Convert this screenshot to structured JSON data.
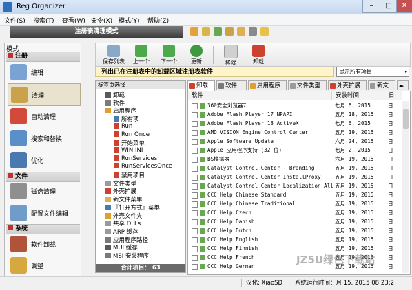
{
  "window": {
    "title": "Reg Organizer",
    "min_glyph": "–",
    "max_glyph": "□",
    "close_glyph": "✕"
  },
  "menu": [
    "文件(S)",
    "搜索(T)",
    "查看(W)",
    "命令(X)",
    "模式(Y)",
    "帮助(Z)"
  ],
  "mode_bar": {
    "title": "注册表清理模式"
  },
  "sidebar": {
    "header": "模式",
    "sections": [
      {
        "title": "注册",
        "items": [
          "编辑",
          "清理",
          "自动清理",
          "搜索和替换",
          "优化"
        ]
      },
      {
        "title": "文件",
        "items": [
          "磁盘清理",
          "配置文件编辑"
        ]
      },
      {
        "title": "系统",
        "items": [
          "软件卸载",
          "调整"
        ]
      }
    ],
    "selected": "清理"
  },
  "toolbar": {
    "buttons": [
      "保存列表",
      "上一个",
      "下一个",
      "更新",
      "移除",
      "卸载"
    ]
  },
  "description": "列出已在注册表中的卸载区域注册表软件",
  "filter": {
    "selected": "显示所有项目",
    "arrow": "▾"
  },
  "tree": {
    "header": "标签页选择",
    "nodes": [
      "卸载",
      "软件",
      "启用程序",
      "所有项",
      "Run",
      "Run Once",
      "开始菜单",
      "WIN.INI",
      "RunServices",
      "RunServicesOnce",
      "禁用项目",
      "文件类型",
      "外壳扩展",
      "新文件菜单",
      "『打开方式』菜单",
      "外壳文件夹",
      "共享 DLLs",
      "ARP 缓存",
      "应用程序路径",
      "MUI 缓存",
      "MSI 安装程序"
    ],
    "total_label": "合计项目：",
    "total": "63"
  },
  "tabs": [
    "卸载",
    "软件",
    "启用程序",
    "文件类型",
    "外壳扩展",
    "新文"
  ],
  "list": {
    "columns": [
      "软件",
      "安装时间",
      "日"
    ],
    "rows": [
      {
        "name": "360安全浏览器7",
        "date": "七月 6, 2015",
        "col3": "日"
      },
      {
        "name": "Adobe Flash Player 17 NPAPI",
        "date": "五月 18, 2015",
        "col3": "日"
      },
      {
        "name": "Adobe Flash Player 18 ActiveX",
        "date": "七月 6, 2015",
        "col3": "日"
      },
      {
        "name": "AMD VISION Engine Control Center",
        "date": "五月 19, 2015",
        "col3": "日"
      },
      {
        "name": "Apple Software Update",
        "date": "六月 24, 2015",
        "col3": "日"
      },
      {
        "name": "Apple 应用程序支持 (32 位)",
        "date": "七月 2, 2015",
        "col3": "日"
      },
      {
        "name": "BS模拟器",
        "date": "六月 19, 2015",
        "col3": "日"
      },
      {
        "name": "Catalyst Control Center - Branding",
        "date": "五月 19, 2015",
        "col3": "日"
      },
      {
        "name": "Catalyst Control Center InstallProxy",
        "date": "五月 19, 2015",
        "col3": "日"
      },
      {
        "name": "Catalyst Control Center Localization All",
        "date": "五月 19, 2015",
        "col3": "日"
      },
      {
        "name": "CCC Help Chinese Standard",
        "date": "五月 19, 2015",
        "col3": "日"
      },
      {
        "name": "CCC Help Chinese Traditional",
        "date": "五月 19, 2015",
        "col3": "日"
      },
      {
        "name": "CCC Help Czech",
        "date": "五月 19, 2015",
        "col3": "日"
      },
      {
        "name": "CCC Help Danish",
        "date": "五月 19, 2015",
        "col3": "日"
      },
      {
        "name": "CCC Help Dutch",
        "date": "五月 19, 2015",
        "col3": "日"
      },
      {
        "name": "CCC Help English",
        "date": "五月 19, 2015",
        "col3": "日"
      },
      {
        "name": "CCC Help Finnish",
        "date": "五月 19, 2015",
        "col3": "日"
      },
      {
        "name": "CCC Help French",
        "date": "五月 19, 2015",
        "col3": "日"
      },
      {
        "name": "CCC Help German",
        "date": "五月 19, 2015",
        "col3": "日"
      }
    ]
  },
  "status": {
    "localized": "汉化: XiaoSD",
    "uptime": "系统运行时间：月 15, 2015 08:23:2",
    "watermark": "JZ5U绿色下载站"
  },
  "colors": {
    "mode_bar": "#4a4a4a",
    "row_icon": "#6aa84f",
    "desc_bg": "#fff5c8"
  }
}
